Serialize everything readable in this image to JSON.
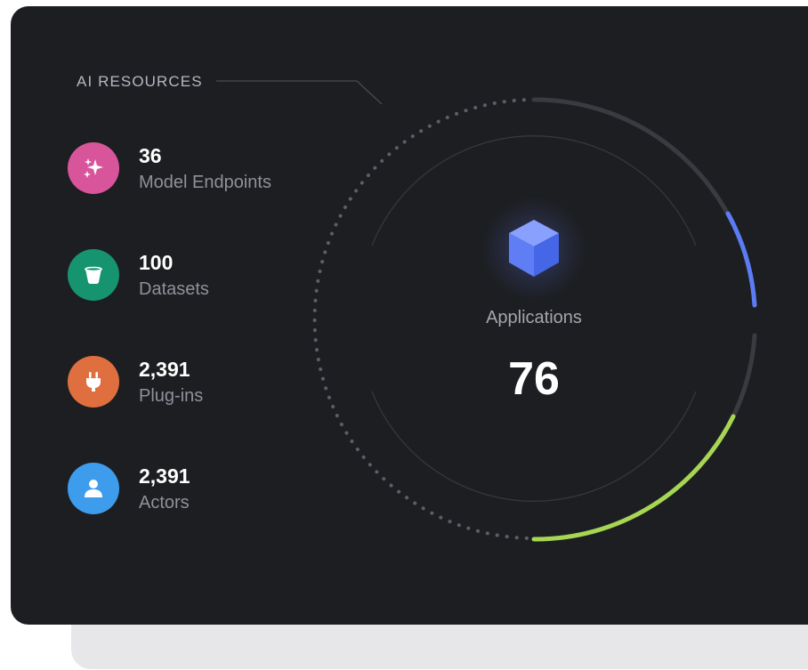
{
  "section": {
    "title": "AI RESOURCES"
  },
  "resources": [
    {
      "value": "36",
      "label": "Model Endpoints",
      "icon": "sparkles-icon",
      "color": "#d9559b"
    },
    {
      "value": "100",
      "label": "Datasets",
      "icon": "bucket-icon",
      "color": "#16936f"
    },
    {
      "value": "2,391",
      "label": "Plug-ins",
      "icon": "plug-icon",
      "color": "#df6f3f"
    },
    {
      "value": "2,391",
      "label": "Actors",
      "icon": "user-icon",
      "color": "#3e9cec"
    }
  ],
  "center": {
    "label": "Applications",
    "value": "76",
    "icon": "cube-icon"
  },
  "gauge": {
    "segments": [
      {
        "name": "blue",
        "color": "#5b7cf4"
      },
      {
        "name": "green",
        "color": "#a6d653"
      }
    ]
  },
  "colors": {
    "panel": "#1d1e21",
    "track": "#3a3c42",
    "text_primary": "#ffffff",
    "text_secondary": "#8e919a"
  }
}
